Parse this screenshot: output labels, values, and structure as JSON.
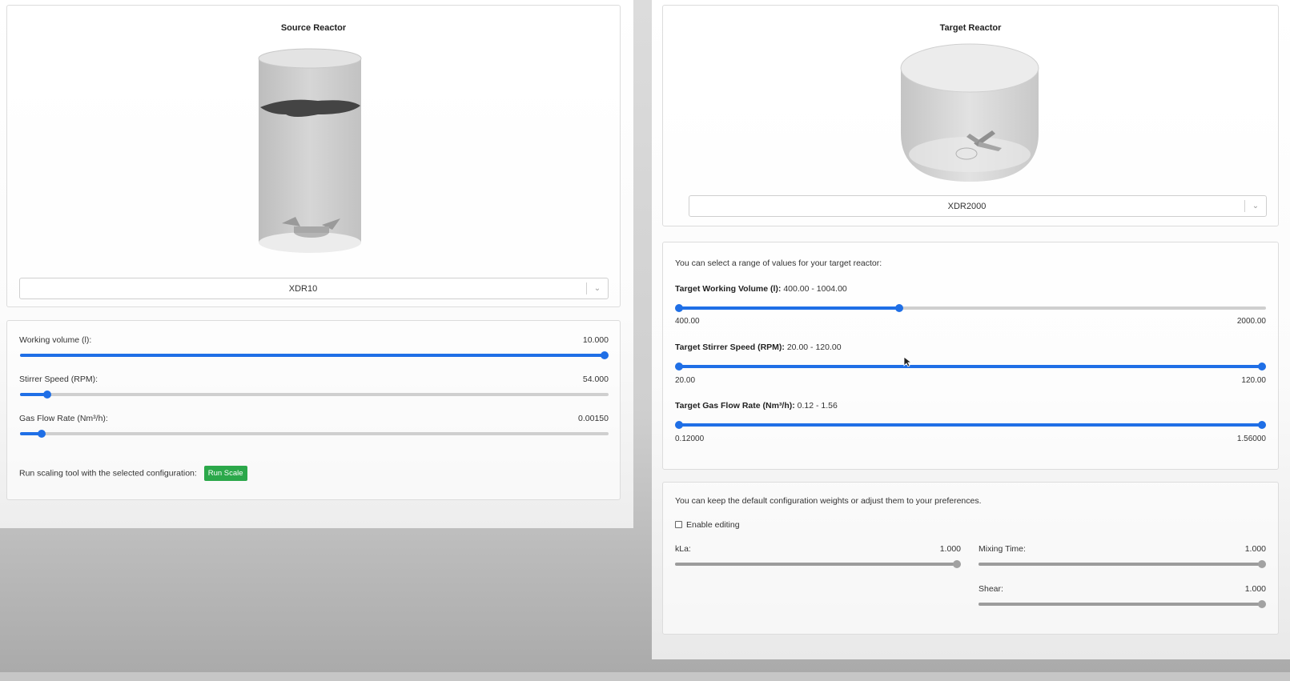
{
  "source": {
    "title": "Source Reactor",
    "reactor_select": "XDR10",
    "sliders": [
      {
        "label": "Working volume (l):",
        "value": "10.000",
        "fraction": 1.0
      },
      {
        "label": "Stirrer Speed (RPM):",
        "value": "54.000",
        "fraction": 0.04
      },
      {
        "label": "Gas Flow Rate (Nm³/h):",
        "value": "0.00150",
        "fraction": 0.03
      }
    ],
    "run_text": "Run scaling tool with the selected configuration:",
    "run_button": "Run Scale"
  },
  "target": {
    "title": "Target Reactor",
    "reactor_select": "XDR2000",
    "range_intro": "You can select a range of values for your target reactor:",
    "ranges": [
      {
        "label": "Target Working Volume (l):",
        "range": "400.00 - 1004.00",
        "min": "400.00",
        "max": "2000.00",
        "low": 0.0,
        "high": 0.3775
      },
      {
        "label": "Target Stirrer Speed (RPM):",
        "range": "20.00 - 120.00",
        "min": "20.00",
        "max": "120.00",
        "low": 0.0,
        "high": 1.0
      },
      {
        "label": "Target Gas Flow Rate (Nm³/h):",
        "range": "0.12 - 1.56",
        "min": "0.12000",
        "max": "1.56000",
        "low": 0.0,
        "high": 1.0
      }
    ],
    "weights_intro": "You can keep the default configuration weights or adjust them to your preferences.",
    "enable_editing": "Enable editing",
    "weights": [
      {
        "label": "kLa:",
        "value": "1.000",
        "fraction": 1.0
      },
      {
        "label": "Mixing Time:",
        "value": "1.000",
        "fraction": 1.0
      },
      {
        "label": "Shear:",
        "value": "1.000",
        "fraction": 1.0
      }
    ]
  },
  "colors": {
    "accent": "#1f6fe6",
    "run_button": "#2ba84a",
    "disabled_slider": "#a2a2a2"
  }
}
